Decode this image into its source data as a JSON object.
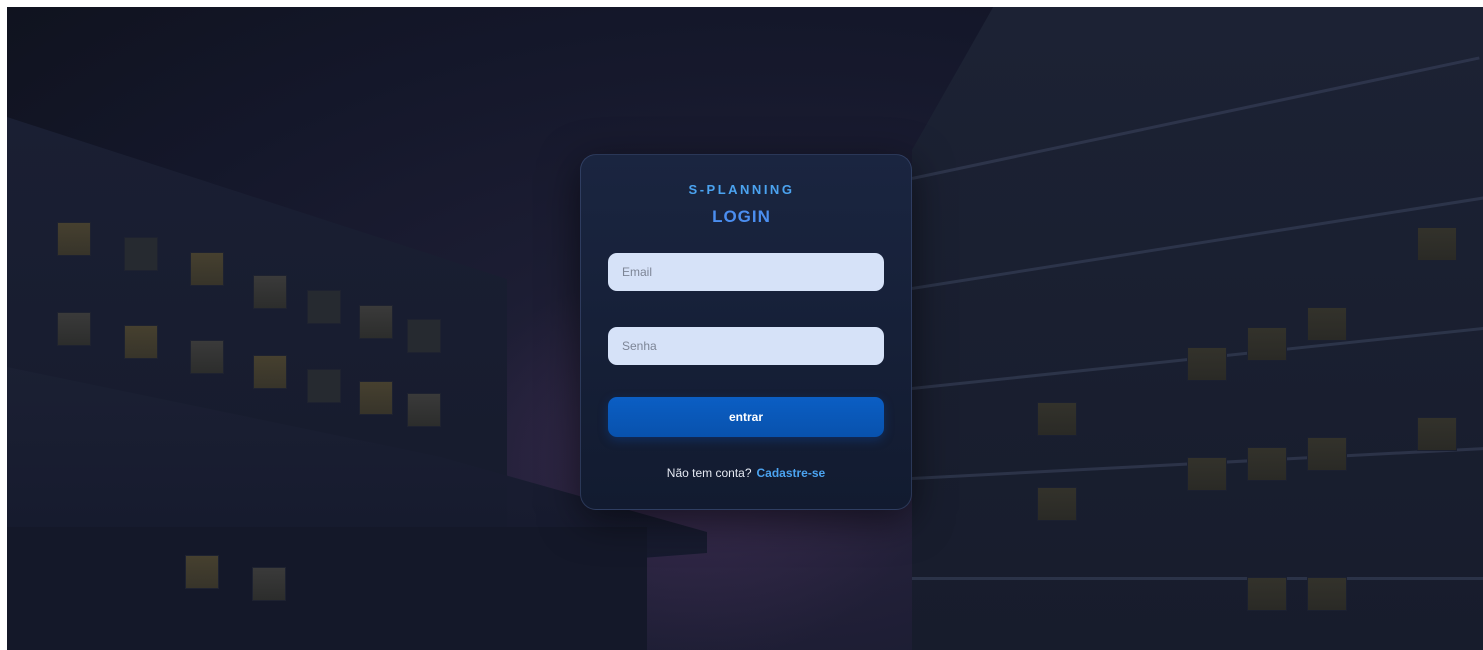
{
  "login_card": {
    "brand": "S-PLANNING",
    "title": "LOGIN",
    "email_placeholder": "Email",
    "password_placeholder": "Senha",
    "submit_label": "entrar",
    "signup_prompt": "Não tem conta?",
    "signup_link": "Cadastre-se"
  },
  "colors": {
    "accent": "#4ba3f0",
    "button": "#0b5ec4",
    "card_background": "#1a2540",
    "input_background": "#d6e2f8"
  }
}
